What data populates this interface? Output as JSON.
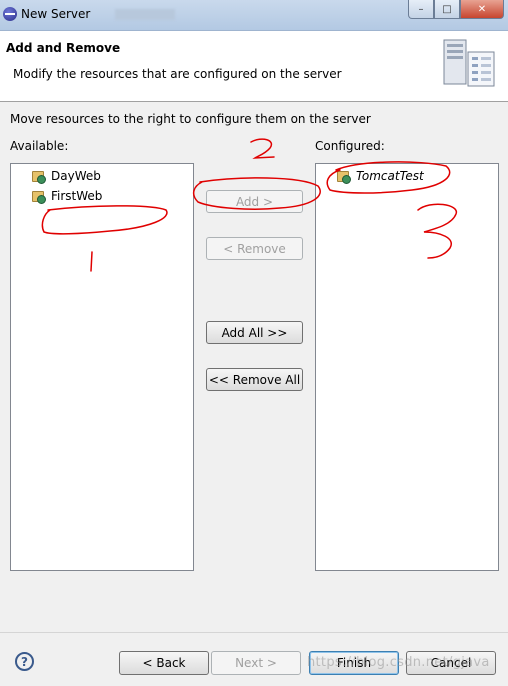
{
  "window": {
    "title": "New Server",
    "controls": [
      "minimize",
      "maximize",
      "close"
    ]
  },
  "banner": {
    "title": "Add and Remove",
    "description": "Modify the resources that are configured on the server"
  },
  "main": {
    "hint": "Move resources to the right to configure them on the server",
    "available_label": "Available:",
    "configured_label": "Configured:",
    "available_items": [
      "DayWeb",
      "FirstWeb"
    ],
    "configured_items": [
      "TomcatTest"
    ]
  },
  "actions": {
    "add": "Add >",
    "remove": "< Remove",
    "add_all": "Add All >>",
    "remove_all": "<< Remove All"
  },
  "footer": {
    "help": "?",
    "back": "< Back",
    "next": "Next >",
    "finish": "Finish",
    "cancel": "Cancel",
    "watermark": "https://blog.csdn.net/gjava"
  },
  "annotations": {
    "marks": [
      "1",
      "2",
      "3"
    ],
    "color": "#e00000"
  }
}
